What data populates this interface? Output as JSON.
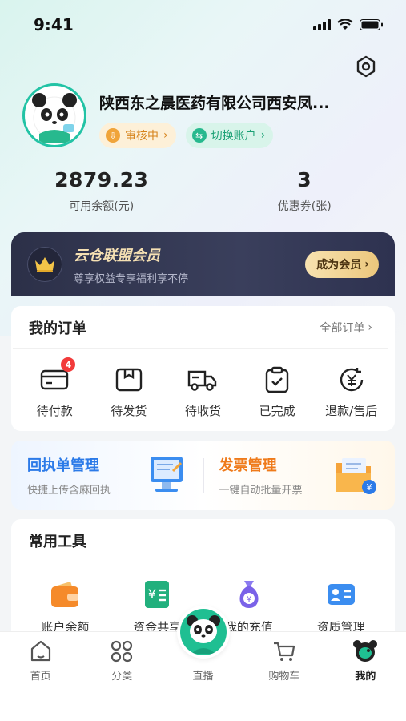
{
  "status_bar": {
    "time": "9:41"
  },
  "profile": {
    "company": "陕西东之晨医药有限公司西安凤...",
    "review_tag": "审核中",
    "switch_tag": "切换账户"
  },
  "stats": [
    {
      "value": "2879.23",
      "label": "可用余额(元)"
    },
    {
      "value": "3",
      "label": "优惠券(张)"
    }
  ],
  "vip": {
    "title": "云仓联盟会员",
    "subtitle": "尊享权益专享福利享不停",
    "button": "成为会员"
  },
  "orders": {
    "title": "我的订单",
    "all_link": "全部订单",
    "items": [
      {
        "label": "待付款",
        "badge": "4",
        "icon": "card-icon"
      },
      {
        "label": "待发货",
        "icon": "box-icon"
      },
      {
        "label": "待收货",
        "icon": "truck-icon"
      },
      {
        "label": "已完成",
        "icon": "clipboard-check-icon"
      },
      {
        "label": "退款/售后",
        "icon": "refund-icon"
      }
    ]
  },
  "management": {
    "receipt": {
      "title": "回执单管理",
      "subtitle": "快捷上传含麻回执",
      "color": "#2b7ae8"
    },
    "invoice": {
      "title": "发票管理",
      "subtitle": "一键自动批量开票",
      "color": "#ef7a1a"
    }
  },
  "tools": {
    "title": "常用工具",
    "items": [
      {
        "label": "账户余额",
        "icon": "wallet-icon"
      },
      {
        "label": "资金共享",
        "icon": "fund-icon"
      },
      {
        "label": "我的充值",
        "icon": "money-bag-icon"
      },
      {
        "label": "资质管理",
        "icon": "id-card-icon"
      }
    ]
  },
  "tabbar": {
    "items": [
      {
        "label": "首页",
        "icon": "home-icon"
      },
      {
        "label": "分类",
        "icon": "category-icon"
      },
      {
        "label": "直播",
        "icon": "live-icon"
      },
      {
        "label": "购物车",
        "icon": "cart-icon"
      },
      {
        "label": "我的",
        "icon": "profile-icon"
      }
    ]
  },
  "colors": {
    "accent": "#1fbf92",
    "badge": "#f23b3b",
    "vip_bg": "#2c3048",
    "vip_gold": "#f5e0b3"
  }
}
